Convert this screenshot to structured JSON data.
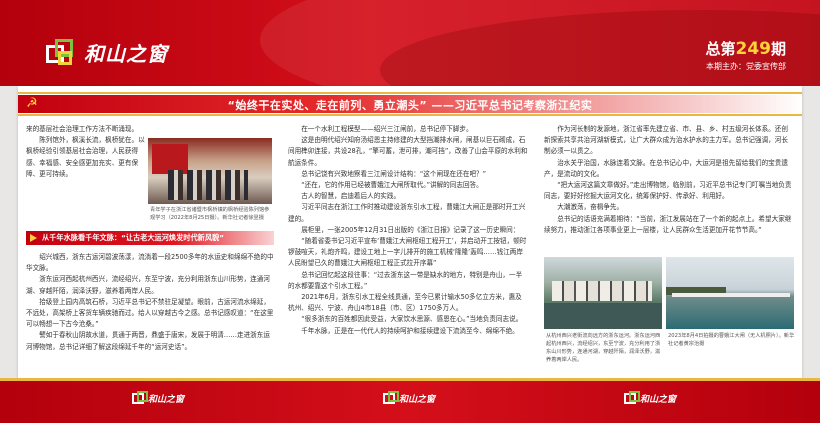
{
  "header": {
    "logo_text": "和山之窗",
    "issue_prefix": "总第",
    "issue_number": "249",
    "issue_suffix": "期",
    "host": "本期主办：党委宣传部"
  },
  "title": "“始终干在实处、走在前列、勇立潮头” ——习近平总书记考察浙江纪实",
  "col1_top": [
    "来的基层社会治理工作方法不断涌现。",
    "陈列馆外，枫溪长流，枫桥犹在。以枫桥经验引领基层社会治理，人民获得感、幸福感、安全感更加充实、更有保障、更可持续。"
  ],
  "photo1_caption": "青年学子在浙江省诸暨市枫桥镇的枫桥经验陈列馆参观学习（2022年8月25日摄）。新华社记者徐昱摄",
  "subhead": "从千年水脉看千年文脉：“让古老大运河焕发时代新风貌”",
  "col1_bottom": [
    "绍兴城西，浙东古运河碧波荡漾，流淌着一段2500多年的水运史和绵绵不绝的中华文脉。",
    "浙东运河西起杭州西兴，流经绍兴，东至宁波，充分利用浙东山川形势，连通河湖、穿越阡陌，润泽沃野，滋养着两岸人民。",
    "拾级登上园内高筑石桥，习近平总书记不禁驻足凝望。眼前，古运河流水绵延，不远处，高架桥上客货车辆疾驰而过。给人以穿越古今之感。总书记感叹道：“在这里可以畅想一下古今沧桑。”",
    "譬如于春秋山阴故水道，贯通于两晋，鼎盛于唐宋，发展于明清……走进浙东运河博物馆，总书记详细了解这段绵延千年的“运河史话”。"
  ],
  "col2": [
    "在一个水利工程模型——绍兴三江闸前，总书记停下脚步。",
    "这是由明代绍兴知府汤绍恩主持修建的大型挡潮排水闸，闸基以巨石砌成，石间用榫卯连接，共设28孔，“擎可蓄，泄可排，潮可挡”，改善了山会平原的水利和航运条件。",
    "总书记饶有兴致地察看三江闸设计结构：“这个闸现在还在吧？”",
    "“还在，它的作用已经被曹娥江大闸所取代。”讲解的同志回答。",
    "古人的智慧，启迪着后人的实践。",
    "习近平同志在浙江工作时推动建设浙东引水工程，曹娥江大闸正是那时开工兴建的。",
    "展柜里，一张2005年12月31日出版的《浙江日报》记录了这一历史瞬间：",
    "“随着省委书记习近平宣布‘曹娥江大闸枢纽工程开工’，并启动开工按钮，顿时锣鼓喧天，礼炮齐鸣，建设工地上一字儿排开的施工机械‘隆隆’轰鸣……钱江两岸人民盼望已久的曹娥江大闸枢纽工程正式拉开序幕”",
    "总书记回忆起这段往事：“过去浙东这一带是缺水的地方，特别是舟山，一半的水都要靠这个引水工程。”",
    "2021年6月，浙东引水工程全线贯通，至今已累计输水50多亿立方米，惠及杭州、绍兴、宁波、舟山4市18县（市、区）1750多万人。",
    "“很多浙东的百姓都因此受益，大家饮水思源、感恩在心。”当地负责同志说。",
    "千年水脉，正是在一代代人的持续呵护和接续建设下流淌至今、绵绵不绝。"
  ],
  "col3": [
    "作为河长制的发源地，浙江省率先建立省、市、县、乡、村五级河长体系。还创新探索共享共治河湖新模式，让广大群众成为治水护水的主力军。总书记强调，河长制必须一以贯之。",
    "治水关乎治国，水脉连着文脉。在总书记心中，大运河是祖先留给我们的宝贵遗产，是流动的文化。",
    "“把大运河这篇文章做好。”走出博物馆，临别前，习近平总书记专门叮嘱当地负责同志，要好好挖掘大运河文化，统筹保护好、传承好、利用好。",
    "大潮激荡，奋楫争先。",
    "总书记的话语充满着期待：“当前，浙江发展站在了一个新的起点上。希望大家继续努力，推动浙江各项事业更上一层楼，让人民群众生活更加开花节节高。”"
  ],
  "photo2_caption": "从杭州西兴老街流向远方的浙东运河。浙东运河西起杭州西兴，流经绍兴，东至宁波，充分利用了浙东山川形势，连通河湖，穿越阡陌，润泽沃野，滋养着两岸人民。",
  "photo3_caption": "2023年8月4日拍摄的曹娥江大闸（无人机照片）。新华社记者黄宗治摄",
  "footer_logo": "和山之窗"
}
